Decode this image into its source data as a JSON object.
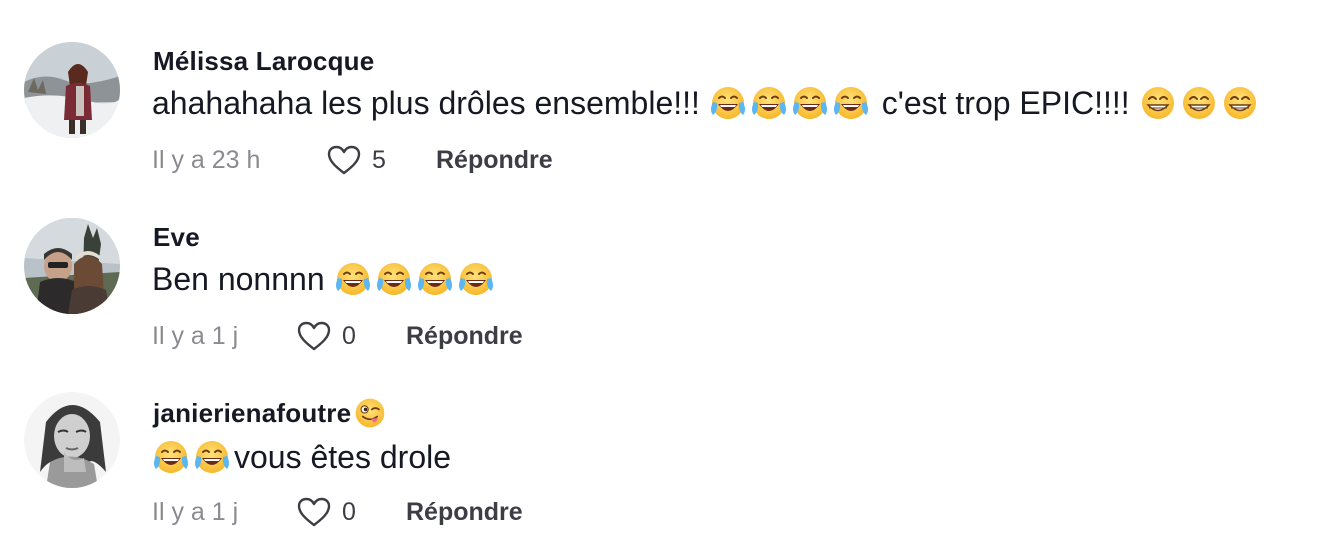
{
  "comments": [
    {
      "username": "Mélissa Larocque",
      "username_emoji": "",
      "text_before": "ahahahaha les plus drôles ensemble!!! ",
      "emojis_a": [
        "face-with-tears-of-joy",
        "face-with-tears-of-joy",
        "face-with-tears-of-joy",
        "face-with-tears-of-joy"
      ],
      "text_after": " c'est trop EPIC!!!! ",
      "emojis_b": [
        "beaming-face",
        "beaming-face",
        "beaming-face"
      ],
      "time": "Il y a 23 h",
      "likes": "5",
      "reply_label": "Répondre"
    },
    {
      "username": "Eve",
      "username_emoji": "",
      "text_before": "Ben nonnnn ",
      "emojis_a": [
        "face-with-tears-of-joy",
        "face-with-tears-of-joy",
        "face-with-tears-of-joy",
        "face-with-tears-of-joy"
      ],
      "text_after": "",
      "emojis_b": [],
      "time": "Il y a 1 j",
      "likes": "0",
      "reply_label": "Répondre"
    },
    {
      "username": "janierienafoutre",
      "username_emoji": "winking-face-with-tongue",
      "text_before": "",
      "emojis_a": [
        "face-with-tears-of-joy",
        "face-with-tears-of-joy"
      ],
      "text_after": "vous êtes drole",
      "emojis_b": [],
      "time": "Il y a 1 j",
      "likes": "0",
      "reply_label": "Répondre"
    }
  ],
  "icons": {
    "like": "heart-outline-icon"
  },
  "colors": {
    "username": "#161823",
    "body": "#161823",
    "time": "#8a8b91",
    "actions": "#3c3d45"
  }
}
